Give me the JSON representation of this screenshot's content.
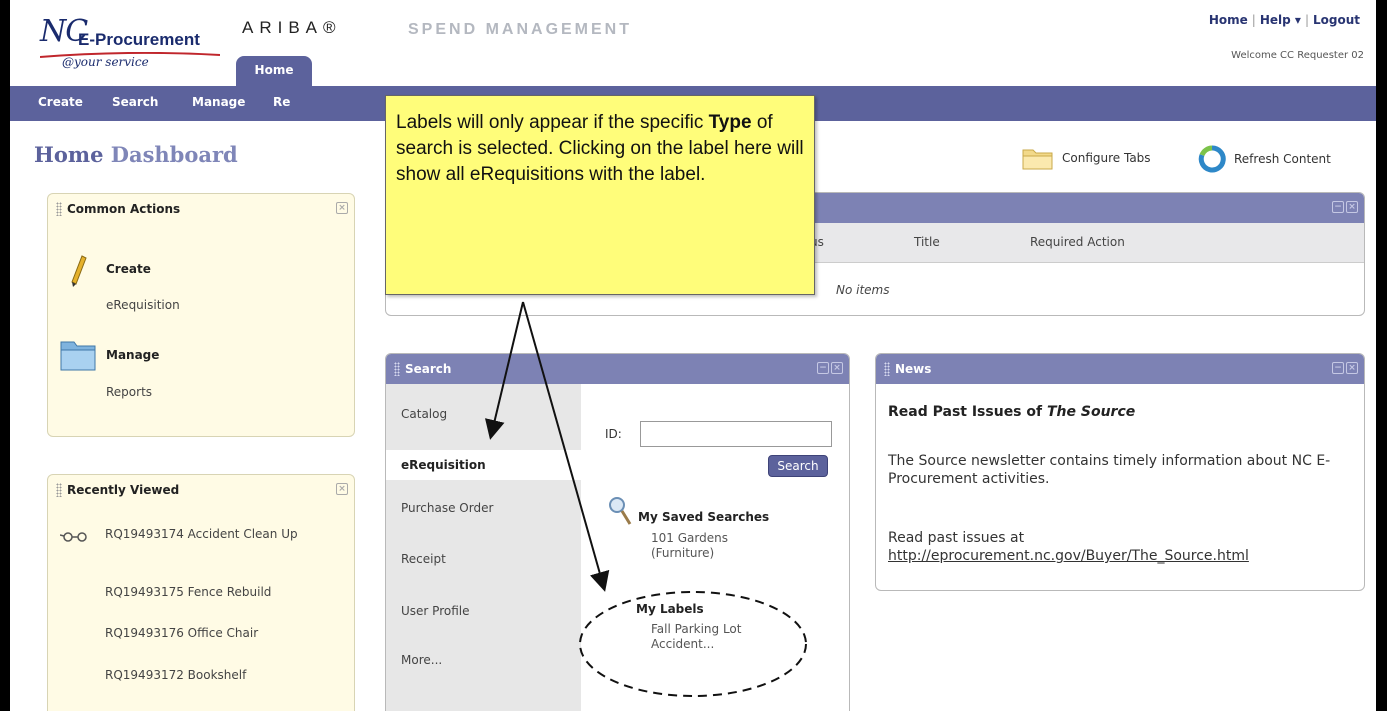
{
  "header": {
    "logo_nc": "NC",
    "logo_ep": "E-Procurement",
    "logo_tagline": "@your service",
    "ariba": "ARIBA®",
    "spend": "SPEND MANAGEMENT",
    "home_tab": "Home",
    "links": [
      "Home",
      "Help ▾",
      "Logout"
    ],
    "welcome": "Welcome CC Requester 02"
  },
  "nav": {
    "items": [
      "Create",
      "Search",
      "Manage",
      "Re"
    ]
  },
  "page": {
    "title_a": "Home",
    "title_b": "Dashboard",
    "configure_tabs": "Configure Tabs",
    "refresh_content": "Refresh Content"
  },
  "common_actions": {
    "title": "Common Actions",
    "create_title": "Create",
    "create_link": "eRequisition",
    "manage_title": "Manage",
    "manage_link": "Reports"
  },
  "recently_viewed": {
    "title": "Recently Viewed",
    "items": [
      "RQ19493174 Accident Clean Up",
      "RQ19493175 Fence Rebuild",
      "RQ19493176 Office Chair",
      "RQ19493172 Bookshelf"
    ]
  },
  "todo": {
    "col_status": "us",
    "col_title": "Title",
    "col_action": "Required Action",
    "empty": "No items"
  },
  "search": {
    "title": "Search",
    "tabs": [
      "Catalog",
      "eRequisition",
      "Purchase Order",
      "Receipt",
      "User Profile",
      "More..."
    ],
    "active_tab": "eRequisition",
    "id_label": "ID:",
    "id_value": "",
    "button": "Search",
    "saved_title": "My Saved Searches",
    "saved_items": [
      "101 Gardens (Furniture)"
    ],
    "labels_title": "My Labels",
    "label_items": [
      "Fall Parking Lot Accident..."
    ]
  },
  "news": {
    "title": "News",
    "headline_pre": "Read Past Issues of ",
    "headline_em": "The Source",
    "body": "The Source newsletter contains timely information about NC E-Procurement activities.",
    "read_past": "Read past issues at",
    "link": "http://eprocurement.nc.gov/Buyer/The_Source.html"
  },
  "callout": {
    "text_1": "Labels will only appear if the specific ",
    "text_bold": "Type",
    "text_2": " of search is selected.  Clicking on the label here will show all eRequisitions with the label."
  },
  "colors": {
    "nav": "#5c629c",
    "portlet_header": "#7d82b4",
    "callout": "#fffd7a"
  }
}
